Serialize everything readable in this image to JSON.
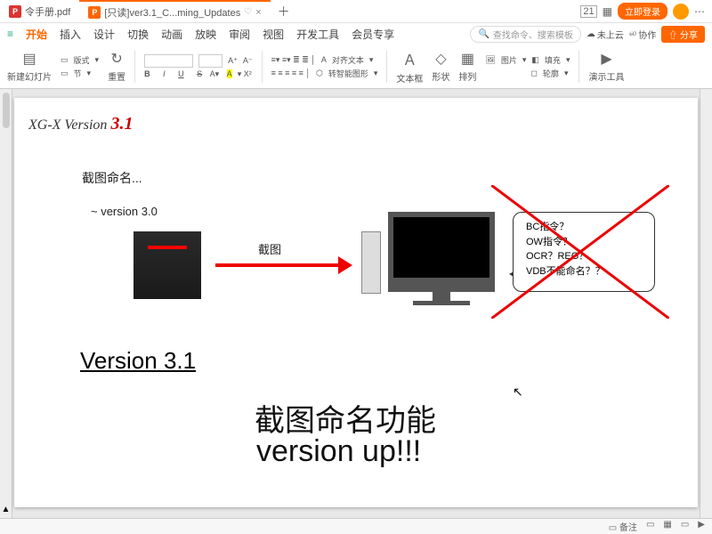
{
  "titlebar": {
    "tabs": [
      {
        "icon": "pdf",
        "label": "令手册.pdf"
      },
      {
        "icon": "wps",
        "label": "[只读]ver3.1_C...ming_Updates",
        "active": true
      }
    ],
    "login": "立即登录",
    "count_badge": "21"
  },
  "menus": {
    "items": [
      "开始",
      "插入",
      "设计",
      "切换",
      "动画",
      "放映",
      "审阅",
      "视图",
      "开发工具",
      "会员专享"
    ],
    "active_index": 0,
    "search_placeholder": "查找命令、搜索模板",
    "cloud": "未上云",
    "coop": "协作",
    "share": "分享"
  },
  "ribbon": {
    "new_slide": "新建幻灯片",
    "layout": "版式",
    "section": "节",
    "reset": "重置",
    "align_label": "对齐文本",
    "smart": "转智能图形",
    "textbox": "文本框",
    "shape": "形状",
    "arrange": "排列",
    "picture": "图片",
    "fill": "填充",
    "outline": "轮廓",
    "present": "演示工具"
  },
  "slide": {
    "ver_prefix": "XG-X Version ",
    "ver_num": "3.1",
    "label1": "截图命名...",
    "label2": "~ version 3.0",
    "arrow_label": "截图",
    "bubble": {
      "l1": "BC指令？",
      "l2": "OW指令？",
      "l3": "OCR？REG？",
      "l4": "VDB不能命名？？"
    },
    "ver31": "Version 3.1",
    "big1": "截图命名功能",
    "big2": "version up!!!"
  },
  "status": {
    "views_label": "",
    "zoom": ""
  }
}
